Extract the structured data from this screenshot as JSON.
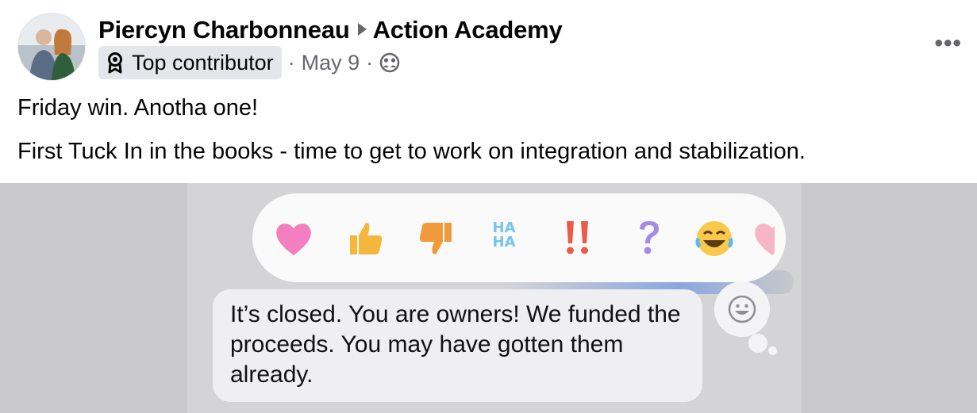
{
  "post": {
    "author": "Piercyn Charbonneau",
    "group": "Action Academy",
    "badge": "Top contributor",
    "date": "May 9",
    "separator": "·",
    "more_label": "•••",
    "text_lines": [
      "Friday win. Anotha one!",
      "First Tuck In in the books - time to get to work on integration and stabilization."
    ]
  },
  "image": {
    "reactions": [
      "heart",
      "thumbs-up",
      "thumbs-down",
      "haha",
      "exclamation",
      "question",
      "laughing",
      "heart-partial"
    ],
    "message": "It’s closed. You are owners! We funded the proceeds. You may have gotten them already."
  }
}
